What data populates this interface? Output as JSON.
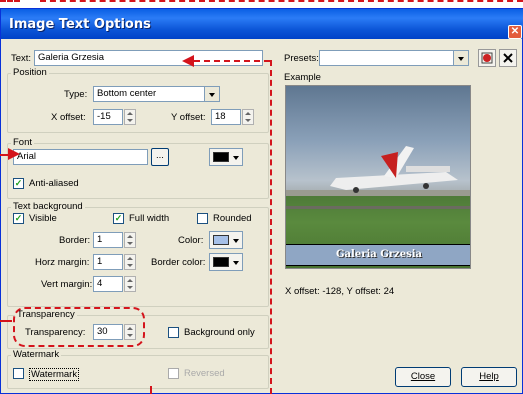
{
  "window": {
    "title": "Image Text Options",
    "close_glyph": "✕"
  },
  "text_row": {
    "label": "Text:",
    "value": "Galeria Grzesia"
  },
  "presets": {
    "label": "Presets:",
    "value": ""
  },
  "position": {
    "group_title": "Position",
    "type_label": "Type:",
    "type_value": "Bottom center",
    "x_label": "X offset:",
    "x_value": "-15",
    "y_label": "Y offset:",
    "y_value": "18"
  },
  "font": {
    "group_title": "Font",
    "value": "Arial",
    "browse_label": "...",
    "antialiased_label": "Anti-aliased",
    "antialiased_checked": true,
    "color": "#000000"
  },
  "text_background": {
    "group_title": "Text background",
    "visible_label": "Visible",
    "visible_checked": true,
    "fullwidth_label": "Full width",
    "fullwidth_checked": true,
    "rounded_label": "Rounded",
    "rounded_checked": false,
    "border_label": "Border:",
    "border_value": "1",
    "color_label": "Color:",
    "color_value": "#a6c0e8",
    "horz_label": "Horz margin:",
    "horz_value": "1",
    "border_color_label": "Border color:",
    "border_color_value": "#000000",
    "vert_label": "Vert margin:",
    "vert_value": "4"
  },
  "transparency": {
    "group_title": "Transparency",
    "label": "Transparency:",
    "value": "30",
    "bg_only_label": "Background only",
    "bg_only_checked": false
  },
  "watermark": {
    "group_title": "Watermark",
    "watermark_label": "Watermark",
    "watermark_checked": false,
    "reversed_label": "Reversed",
    "reversed_checked": false
  },
  "example": {
    "label": "Example",
    "caption": "Galeria Grzesia",
    "offset_text": "X offset: -128, Y offset: 24"
  },
  "buttons": {
    "close": "Close",
    "help": "Help"
  },
  "check_glyph": "✓"
}
